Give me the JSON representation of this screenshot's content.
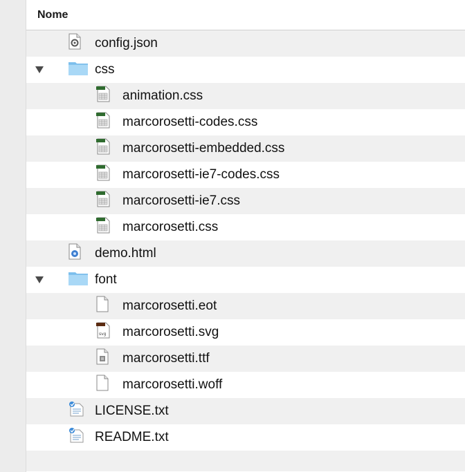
{
  "header": {
    "name_column": "Nome"
  },
  "files": [
    {
      "name": "config.json",
      "icon": "json-file-icon",
      "level": 0
    },
    {
      "name": "css",
      "icon": "folder-icon",
      "level": 0,
      "expanded": true
    },
    {
      "name": "animation.css",
      "icon": "css-file-icon",
      "level": 1
    },
    {
      "name": "marcorosetti-codes.css",
      "icon": "css-file-icon",
      "level": 1
    },
    {
      "name": "marcorosetti-embedded.css",
      "icon": "css-file-icon",
      "level": 1
    },
    {
      "name": "marcorosetti-ie7-codes.css",
      "icon": "css-file-icon",
      "level": 1
    },
    {
      "name": "marcorosetti-ie7.css",
      "icon": "css-file-icon",
      "level": 1
    },
    {
      "name": "marcorosetti.css",
      "icon": "css-file-icon",
      "level": 1
    },
    {
      "name": "demo.html",
      "icon": "html-file-icon",
      "level": 0
    },
    {
      "name": "font",
      "icon": "folder-icon",
      "level": 0,
      "expanded": true
    },
    {
      "name": "marcorosetti.eot",
      "icon": "blank-file-icon",
      "level": 1
    },
    {
      "name": "marcorosetti.svg",
      "icon": "svg-file-icon",
      "level": 1
    },
    {
      "name": "marcorosetti.ttf",
      "icon": "ttf-file-icon",
      "level": 1
    },
    {
      "name": "marcorosetti.woff",
      "icon": "blank-file-icon",
      "level": 1
    },
    {
      "name": "LICENSE.txt",
      "icon": "text-file-icon",
      "level": 0
    },
    {
      "name": "README.txt",
      "icon": "text-file-icon",
      "level": 0
    }
  ]
}
